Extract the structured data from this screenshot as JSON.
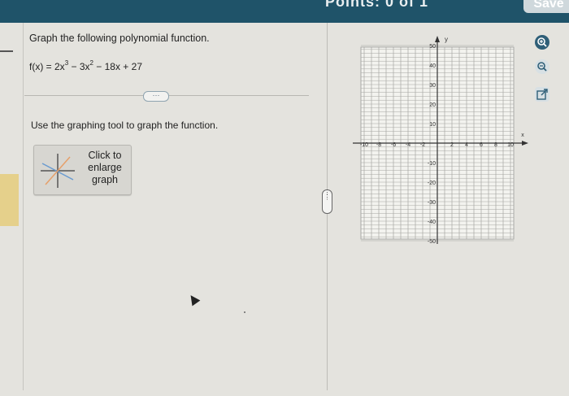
{
  "header": {
    "points_text": "Points: 0 of 1",
    "save_label": "Save"
  },
  "question": {
    "title": "Graph the following polynomial function.",
    "function_prefix": "f(x) = 2x",
    "exp1": "3",
    "mid": " − 3x",
    "exp2": "2",
    "suffix": " − 18x + 27",
    "more_button": "···",
    "instruction": "Use the graphing tool to graph the function.",
    "enlarge_label": "Click to enlarge graph"
  },
  "graph": {
    "x_axis_label": "x",
    "y_axis_label": "y",
    "x_tick_labels": [
      "-10",
      "-8",
      "-6",
      "-4",
      "-2",
      "2",
      "4",
      "6",
      "8",
      "10"
    ],
    "y_tick_labels_pos": [
      "50",
      "40",
      "30",
      "20",
      "10"
    ],
    "y_tick_labels_neg": [
      "-10",
      "-20",
      "-30",
      "-40",
      "-50"
    ]
  },
  "toolbar": {
    "zoom_in": "zoom-in-icon",
    "zoom_out": "zoom-out-icon",
    "popout": "popout-icon"
  },
  "colors": {
    "header_bar": "#1f5369",
    "accent_icon": "#2f5f78"
  }
}
